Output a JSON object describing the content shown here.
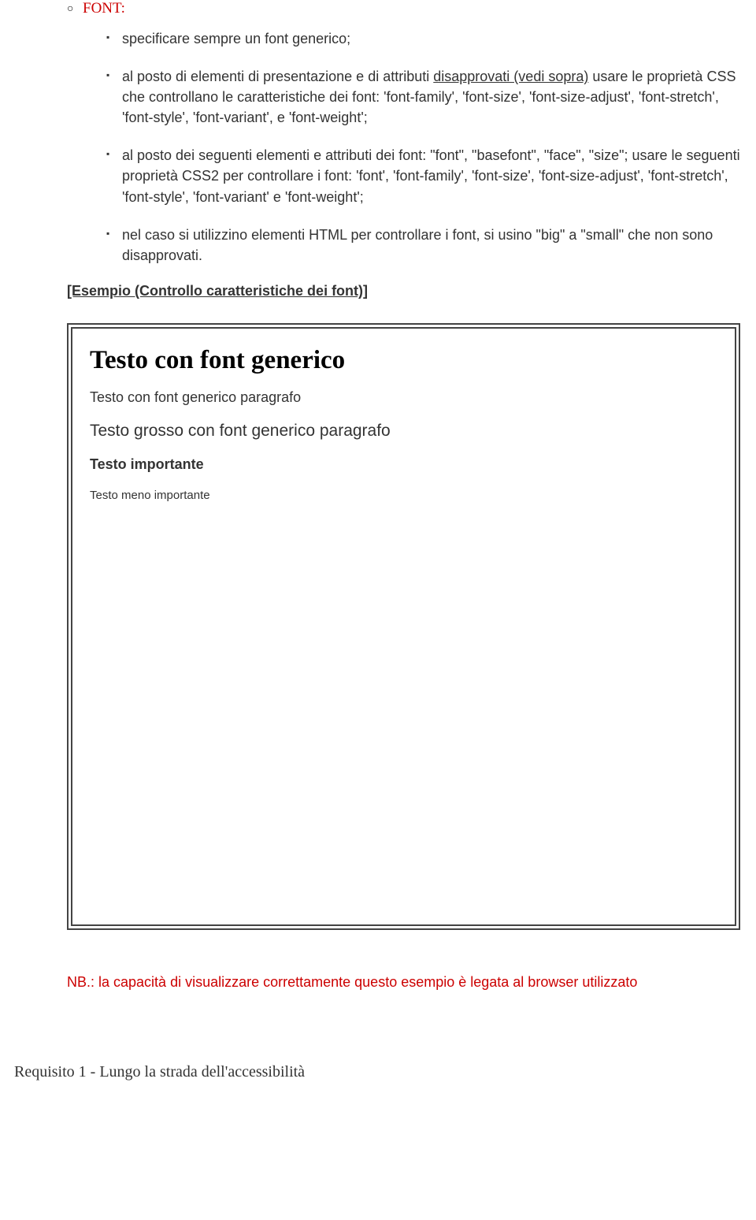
{
  "section": {
    "font_label": "FONT:",
    "items": [
      "specificare sempre un font generico;",
      "al posto di elementi di presentazione e di attributi disapprovati (vedi sopra) usare le proprietà CSS che controllano le caratteristiche dei font: 'font-family', 'font-size', 'font-size-adjust', 'font-stretch', 'font-style', 'font-variant', e 'font-weight';",
      "al posto dei seguenti elementi e attributi dei font: \"font\", \"basefont\", \"face\", \"size\"; usare le seguenti proprietà CSS2 per controllare i font: 'font', 'font-family', 'font-size', 'font-size-adjust', 'font-stretch', 'font-style', 'font-variant' e 'font-weight';",
      "nel caso si utilizzino elementi HTML per controllare i font, si usino \"big\" a \"small\" che non sono disapprovati."
    ],
    "item2_pre": "al posto di elementi di presentazione e di attributi ",
    "item2_underlined": "disapprovati (vedi sopra)",
    "item2_post": " usare le proprietà CSS che controllano le caratteristiche dei font: 'font-family', 'font-size', 'font-size-adjust', 'font-stretch', 'font-style', 'font-variant', e 'font-weight';"
  },
  "esempio_link": "[Esempio (Controllo caratteristiche dei font)]",
  "box": {
    "title": "Testo con font generico",
    "line1": "Testo con font generico paragrafo",
    "line2": "Testo grosso con font generico paragrafo",
    "line3": "Testo importante",
    "line4": "Testo meno importante"
  },
  "nb_text": "NB.: la capacità di visualizzare correttamente questo esempio è legata al browser utilizzato",
  "footer": "Requisito 1 - Lungo la strada dell'accessibilità"
}
